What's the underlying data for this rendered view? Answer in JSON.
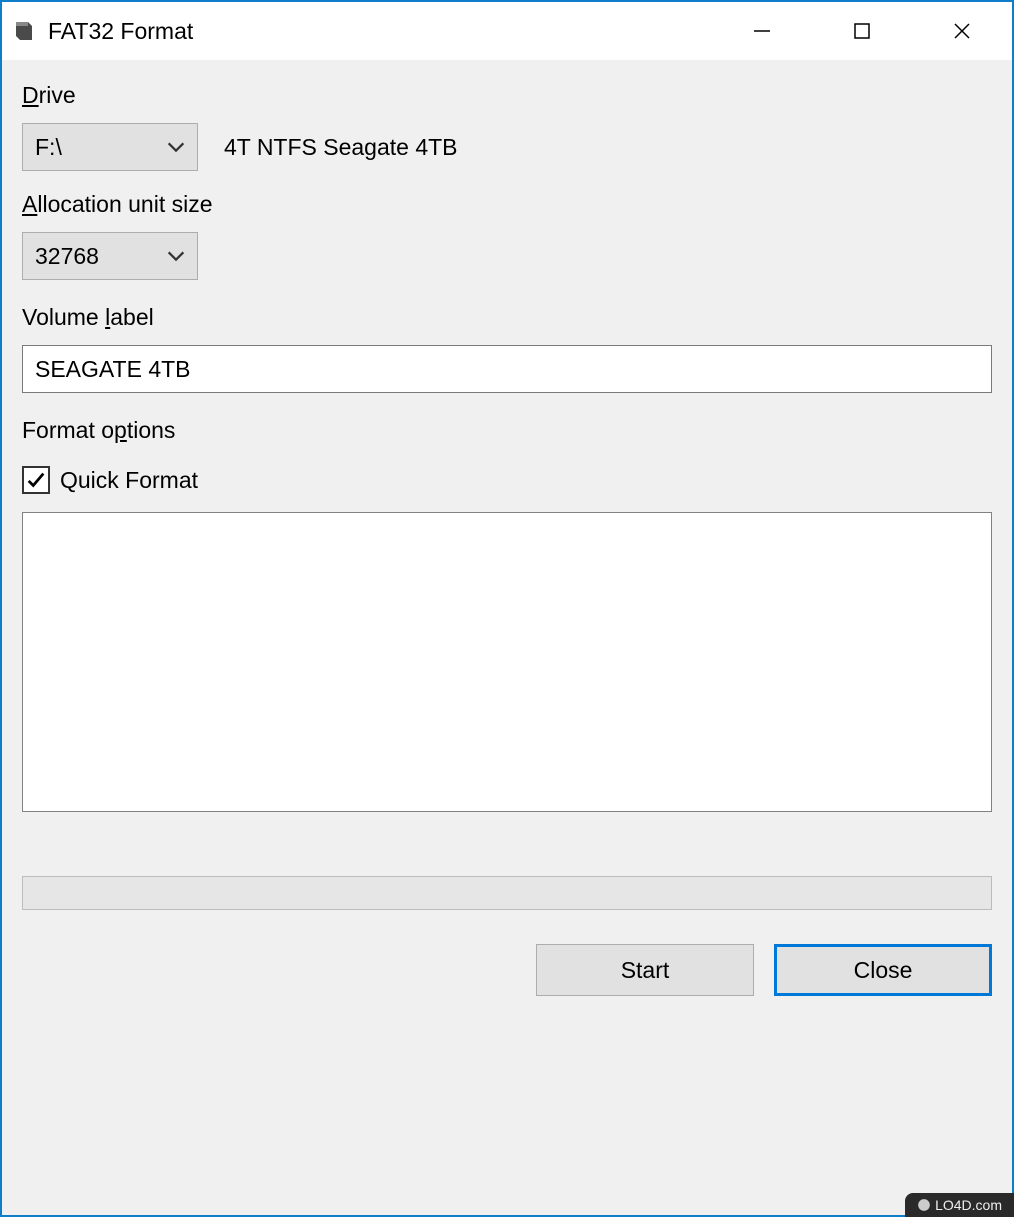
{
  "window": {
    "title": "FAT32 Format"
  },
  "labels": {
    "drive": "Drive",
    "allocation": "Allocation unit size",
    "volume_pre": "Volume ",
    "volume_ul": "l",
    "volume_post": "abel",
    "format_pre": "Format o",
    "format_ul": "p",
    "format_post": "tions",
    "quick_format": "Quick Format"
  },
  "drive": {
    "selected": "F:\\",
    "description": "4T NTFS Seagate 4TB"
  },
  "allocation": {
    "selected": "32768"
  },
  "volume": {
    "value": "SEAGATE 4TB"
  },
  "options": {
    "quick_format_checked": true
  },
  "output": "",
  "buttons": {
    "start": "Start",
    "close": "Close"
  },
  "watermark": "LO4D.com"
}
